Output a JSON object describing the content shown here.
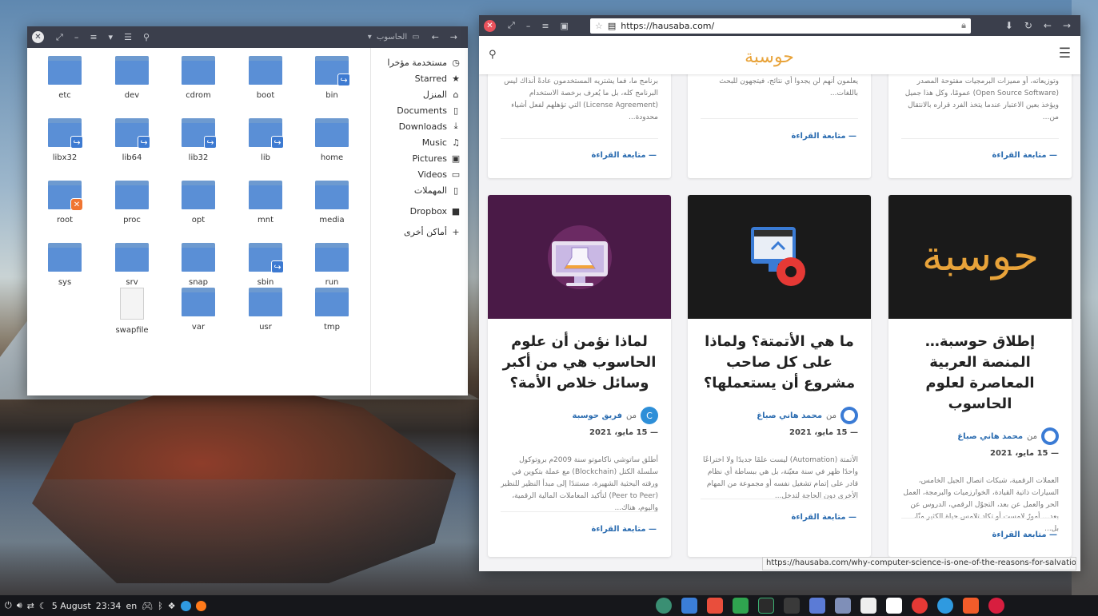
{
  "colors": {
    "titlebar": "#3b3f4c",
    "folder": "#5a8fd6",
    "link_blue": "#2b6cb0",
    "logo_gold": "#e8a33a",
    "card1_bg": "#4a1a47",
    "card_dark_bg": "#1a1a1a"
  },
  "file_manager": {
    "path_label": "الحاسوب",
    "sidebar": [
      {
        "label": "مستخدمة مؤخرا",
        "icon": "clock-icon",
        "glyph": "◷"
      },
      {
        "label": "Starred",
        "icon": "star-icon",
        "glyph": "★"
      },
      {
        "label": "المنزل",
        "icon": "home-icon",
        "glyph": "⌂"
      },
      {
        "label": "Documents",
        "icon": "document-icon",
        "glyph": "▯"
      },
      {
        "label": "Downloads",
        "icon": "download-icon",
        "glyph": "⤓"
      },
      {
        "label": "Music",
        "icon": "music-icon",
        "glyph": "♫"
      },
      {
        "label": "Pictures",
        "icon": "picture-icon",
        "glyph": "▣"
      },
      {
        "label": "Videos",
        "icon": "video-icon",
        "glyph": "▭"
      },
      {
        "label": "المهملات",
        "icon": "trash-icon",
        "glyph": "▯"
      },
      {
        "label": "Dropbox",
        "icon": "folder-icon",
        "glyph": "■"
      },
      {
        "label": "أماكن أخرى",
        "icon": "plus-icon",
        "glyph": "+"
      }
    ],
    "files": [
      {
        "name": "etc",
        "kind": "folder",
        "badge": ""
      },
      {
        "name": "dev",
        "kind": "folder",
        "badge": ""
      },
      {
        "name": "cdrom",
        "kind": "folder",
        "badge": ""
      },
      {
        "name": "boot",
        "kind": "folder",
        "badge": ""
      },
      {
        "name": "bin",
        "kind": "folder",
        "badge": "link"
      },
      {
        "name": "libx32",
        "kind": "folder",
        "badge": "link"
      },
      {
        "name": "lib64",
        "kind": "folder",
        "badge": "link"
      },
      {
        "name": "lib32",
        "kind": "folder",
        "badge": "link"
      },
      {
        "name": "lib",
        "kind": "folder",
        "badge": "link"
      },
      {
        "name": "home",
        "kind": "folder",
        "badge": ""
      },
      {
        "name": "root",
        "kind": "folder",
        "badge": "locked"
      },
      {
        "name": "proc",
        "kind": "folder",
        "badge": ""
      },
      {
        "name": "opt",
        "kind": "folder",
        "badge": ""
      },
      {
        "name": "mnt",
        "kind": "folder",
        "badge": ""
      },
      {
        "name": "media",
        "kind": "folder",
        "badge": ""
      },
      {
        "name": "sys",
        "kind": "folder",
        "badge": ""
      },
      {
        "name": "srv",
        "kind": "folder",
        "badge": ""
      },
      {
        "name": "snap",
        "kind": "folder",
        "badge": ""
      },
      {
        "name": "sbin",
        "kind": "folder",
        "badge": "link"
      },
      {
        "name": "run",
        "kind": "folder",
        "badge": ""
      },
      {
        "name": "swapfile",
        "kind": "file",
        "badge": ""
      },
      {
        "name": "var",
        "kind": "folder",
        "badge": ""
      },
      {
        "name": "usr",
        "kind": "folder",
        "badge": ""
      },
      {
        "name": "tmp",
        "kind": "folder",
        "badge": ""
      }
    ]
  },
  "browser": {
    "url": "https://hausaba.com/",
    "status_url": "https://hausaba.com/why-computer-science-is-one-of-the-reasons-for-salvation/",
    "logo_text": "حوسبة",
    "read_more": "— متابعة القراءة",
    "top_cards": [
      {
        "excerpt": "برنامج ما، فما يشتريه المستخدمون عادةً أنذاك ليس البرنامج كله، بل ما يُعرف برخصة الاستخدام (License Agreement) التي تؤهلهم لفعل أشياء محدودة..."
      },
      {
        "excerpt": "يعلمون أنهم لن يجدوا أي نتائج، فيتجهون للبحث باللغات..."
      },
      {
        "excerpt": "وتوزيعاته، أو مميزات البرمجيات مفتوحة المصدر (Open Source Software) عمومًا، وكل هذا جميل ويؤخذ بعين الاعتبار عندما يتخذ الفرد قراره بالانتقال من..."
      }
    ],
    "cards": [
      {
        "title": "لماذا نؤمن أن علوم الحاسوب هي من أكبر وسائل خلاص الأمة؟",
        "prefix": "من",
        "author": "فريق حوسبة",
        "date": "— 15 مايو، 2021",
        "excerpt": "أطلق ساتوشي ناكاموتو سنة 2009م بروتوكول سلسلة الكتل (Blockchain) مع عملة بتكوين في ورقته البحثية الشهيرة، مستندًا إلى مبدأ النظير للنظير (Peer to Peer) لتأكيد المعاملات المالية الرقمية، واليوم، هناك..."
      },
      {
        "title": "ما هي الأتمتة؟ ولماذا على كل صاحب مشروع أن يستعملها؟",
        "prefix": "من",
        "author": "محمد هاني صباغ",
        "date": "— 15 مايو، 2021",
        "excerpt": "الأتمتة (Automation) ليست علمًا جديدًا ولا اختراعًا واحدًا ظهر في سنة معيّنة، بل هي ببساطة أي نظام قادر على إتمام تشغيل نفسه أو مجموعة من المهام الأخرى دون الحاجة لتدخل..."
      },
      {
        "title": "إطلاق حوسبة… المنصة العربية المعاصرة لعلوم الحاسوب",
        "prefix": "من",
        "author": "محمد هاني صباغ",
        "date": "— 15 مايو، 2021",
        "excerpt": "العملات الرقمية، شبكات اتصال الجيل الخامس، السيارات ذاتية القيادة، الخوارزميات والبرمجة، العمل الحر والعمل عن بعد، التجوّل الرقمي، الدروس عن بعد… أمورٌ لامست أو تكاد تلامس حياة الكثير منّا، بل..."
      }
    ]
  },
  "taskbar": {
    "date": "5 August",
    "time": "23:34",
    "lang": "en"
  }
}
